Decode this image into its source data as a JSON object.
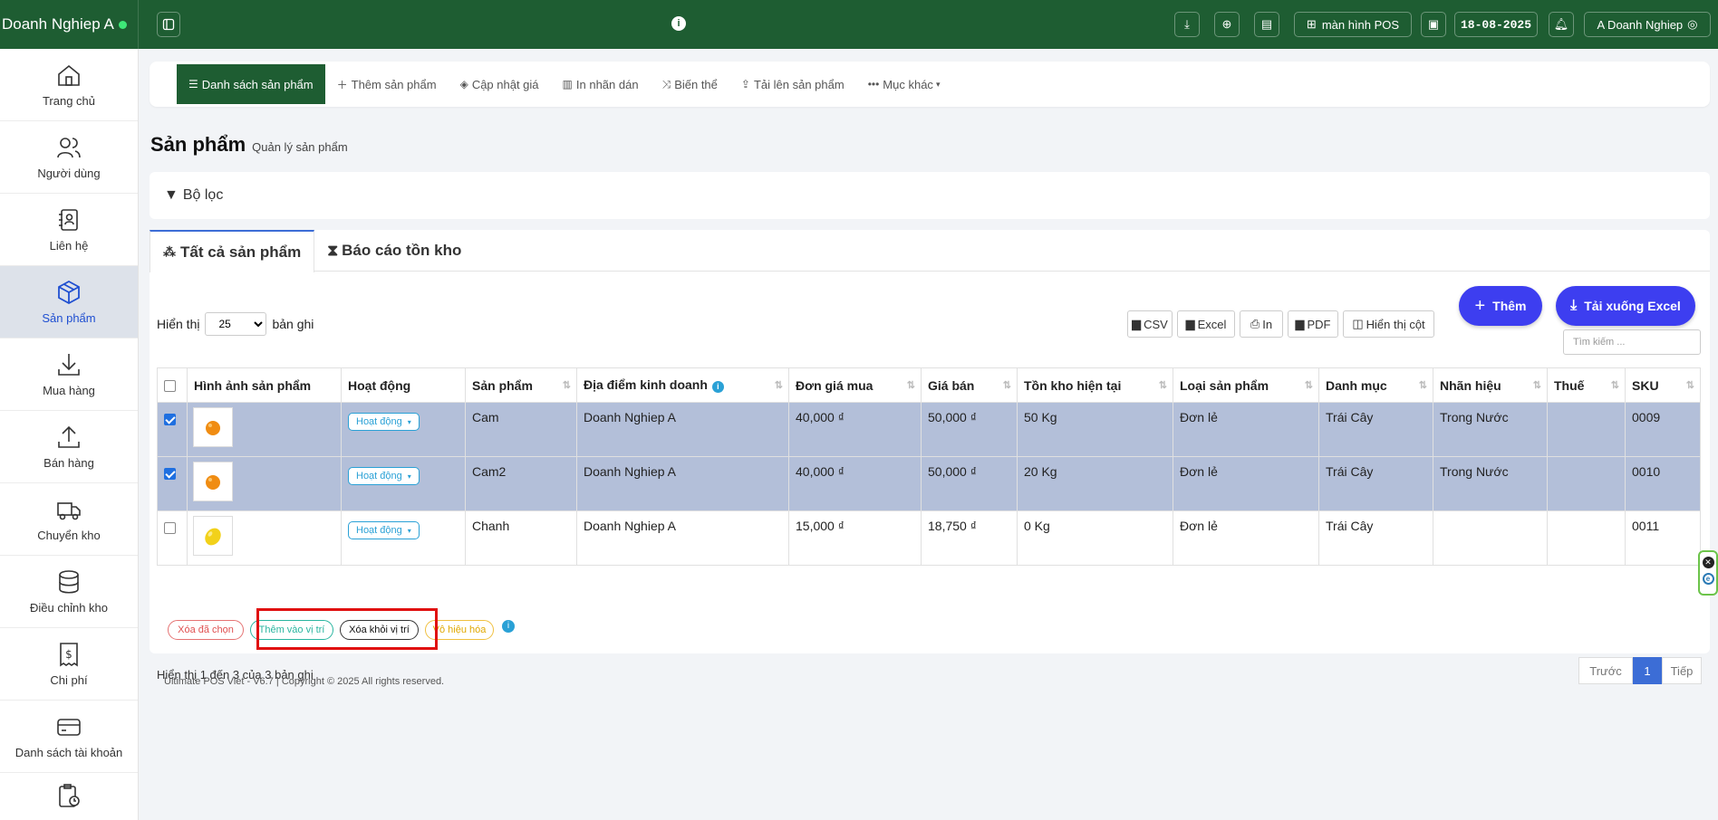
{
  "topbar": {
    "brand": "Doanh Nghiep A",
    "pos_label": "màn hình POS",
    "date": "18-08-2025",
    "user": "A Doanh Nghiep"
  },
  "sidebar": {
    "items": [
      {
        "label": "Trang chủ",
        "icon": "home-icon"
      },
      {
        "label": "Người dùng",
        "icon": "users-icon"
      },
      {
        "label": "Liên hệ",
        "icon": "contacts-icon"
      },
      {
        "label": "Sản phẩm",
        "icon": "box-icon"
      },
      {
        "label": "Mua hàng",
        "icon": "download-icon"
      },
      {
        "label": "Bán hàng",
        "icon": "upload-icon"
      },
      {
        "label": "Chuyển kho",
        "icon": "truck-icon"
      },
      {
        "label": "Điều chỉnh kho",
        "icon": "database-icon"
      },
      {
        "label": "Chi phí",
        "icon": "receipt-icon"
      },
      {
        "label": "Danh sách tài khoản",
        "icon": "card-icon"
      }
    ]
  },
  "subnav": {
    "items": [
      "Danh sách sản phẩm",
      "Thêm sản phẩm",
      "Cập nhật giá",
      "In nhãn dán",
      "Biến thể",
      "Tải lên sản phẩm",
      "Mục khác"
    ]
  },
  "page": {
    "title": "Sản phẩm",
    "subtitle": "Quản lý sản phẩm"
  },
  "filter": {
    "label": "Bộ lọc"
  },
  "tabs": [
    "Tất cả sản phẩm",
    "Báo cáo tồn kho"
  ],
  "controls": {
    "show_prefix": "Hiển thị",
    "show_value": "25",
    "show_suffix": "bản ghi",
    "export": [
      "CSV",
      "Excel",
      "In",
      "PDF",
      "Hiển thị cột"
    ],
    "add_label": "Thêm",
    "download_label": "Tải xuống Excel",
    "search_placeholder": "Tìm kiếm ..."
  },
  "table": {
    "headers": [
      "Hình ảnh sản phẩm",
      "Hoạt động",
      "Sản phẩm",
      "Địa điểm kinh doanh",
      "Đơn giá mua",
      "Giá bán",
      "Tồn kho hiện tại",
      "Loại sản phẩm",
      "Danh mục",
      "Nhãn hiệu",
      "Thuế",
      "SKU"
    ],
    "rows": [
      {
        "checked": true,
        "action": "Hoạt động",
        "product": "Cam",
        "location": "Doanh Nghiep A",
        "buy": "40,000 ₫",
        "sell": "50,000 ₫",
        "stock": "50 Kg",
        "type": "Đơn lẻ",
        "category": "Trái Cây",
        "brand": "Trong Nước",
        "tax": "",
        "sku": "0009",
        "fruit_color": "#f08c12"
      },
      {
        "checked": true,
        "action": "Hoạt động",
        "product": "Cam2",
        "location": "Doanh Nghiep A",
        "buy": "40,000 ₫",
        "sell": "50,000 ₫",
        "stock": "20 Kg",
        "type": "Đơn lẻ",
        "category": "Trái Cây",
        "brand": "Trong Nước",
        "tax": "",
        "sku": "0010",
        "fruit_color": "#f08c12"
      },
      {
        "checked": false,
        "action": "Hoạt động",
        "product": "Chanh",
        "location": "Doanh Nghiep A",
        "buy": "15,000 ₫",
        "sell": "18,750 ₫",
        "stock": "0 Kg",
        "type": "Đơn lẻ",
        "category": "Trái Cây",
        "brand": "",
        "tax": "",
        "sku": "0011",
        "fruit_color": "#f2d11a"
      }
    ]
  },
  "bulk": [
    "Xóa đã chọn",
    "Thêm vào vị trí",
    "Xóa khỏi vị trí",
    "Vô hiệu hóa"
  ],
  "info": "Hiển thị 1 đến 3 của 3 bản ghi",
  "pager": {
    "prev": "Trước",
    "page": "1",
    "next": "Tiếp"
  },
  "footer": "Ultimate POS Viet - V6.7 | Copyright © 2025 All rights reserved."
}
